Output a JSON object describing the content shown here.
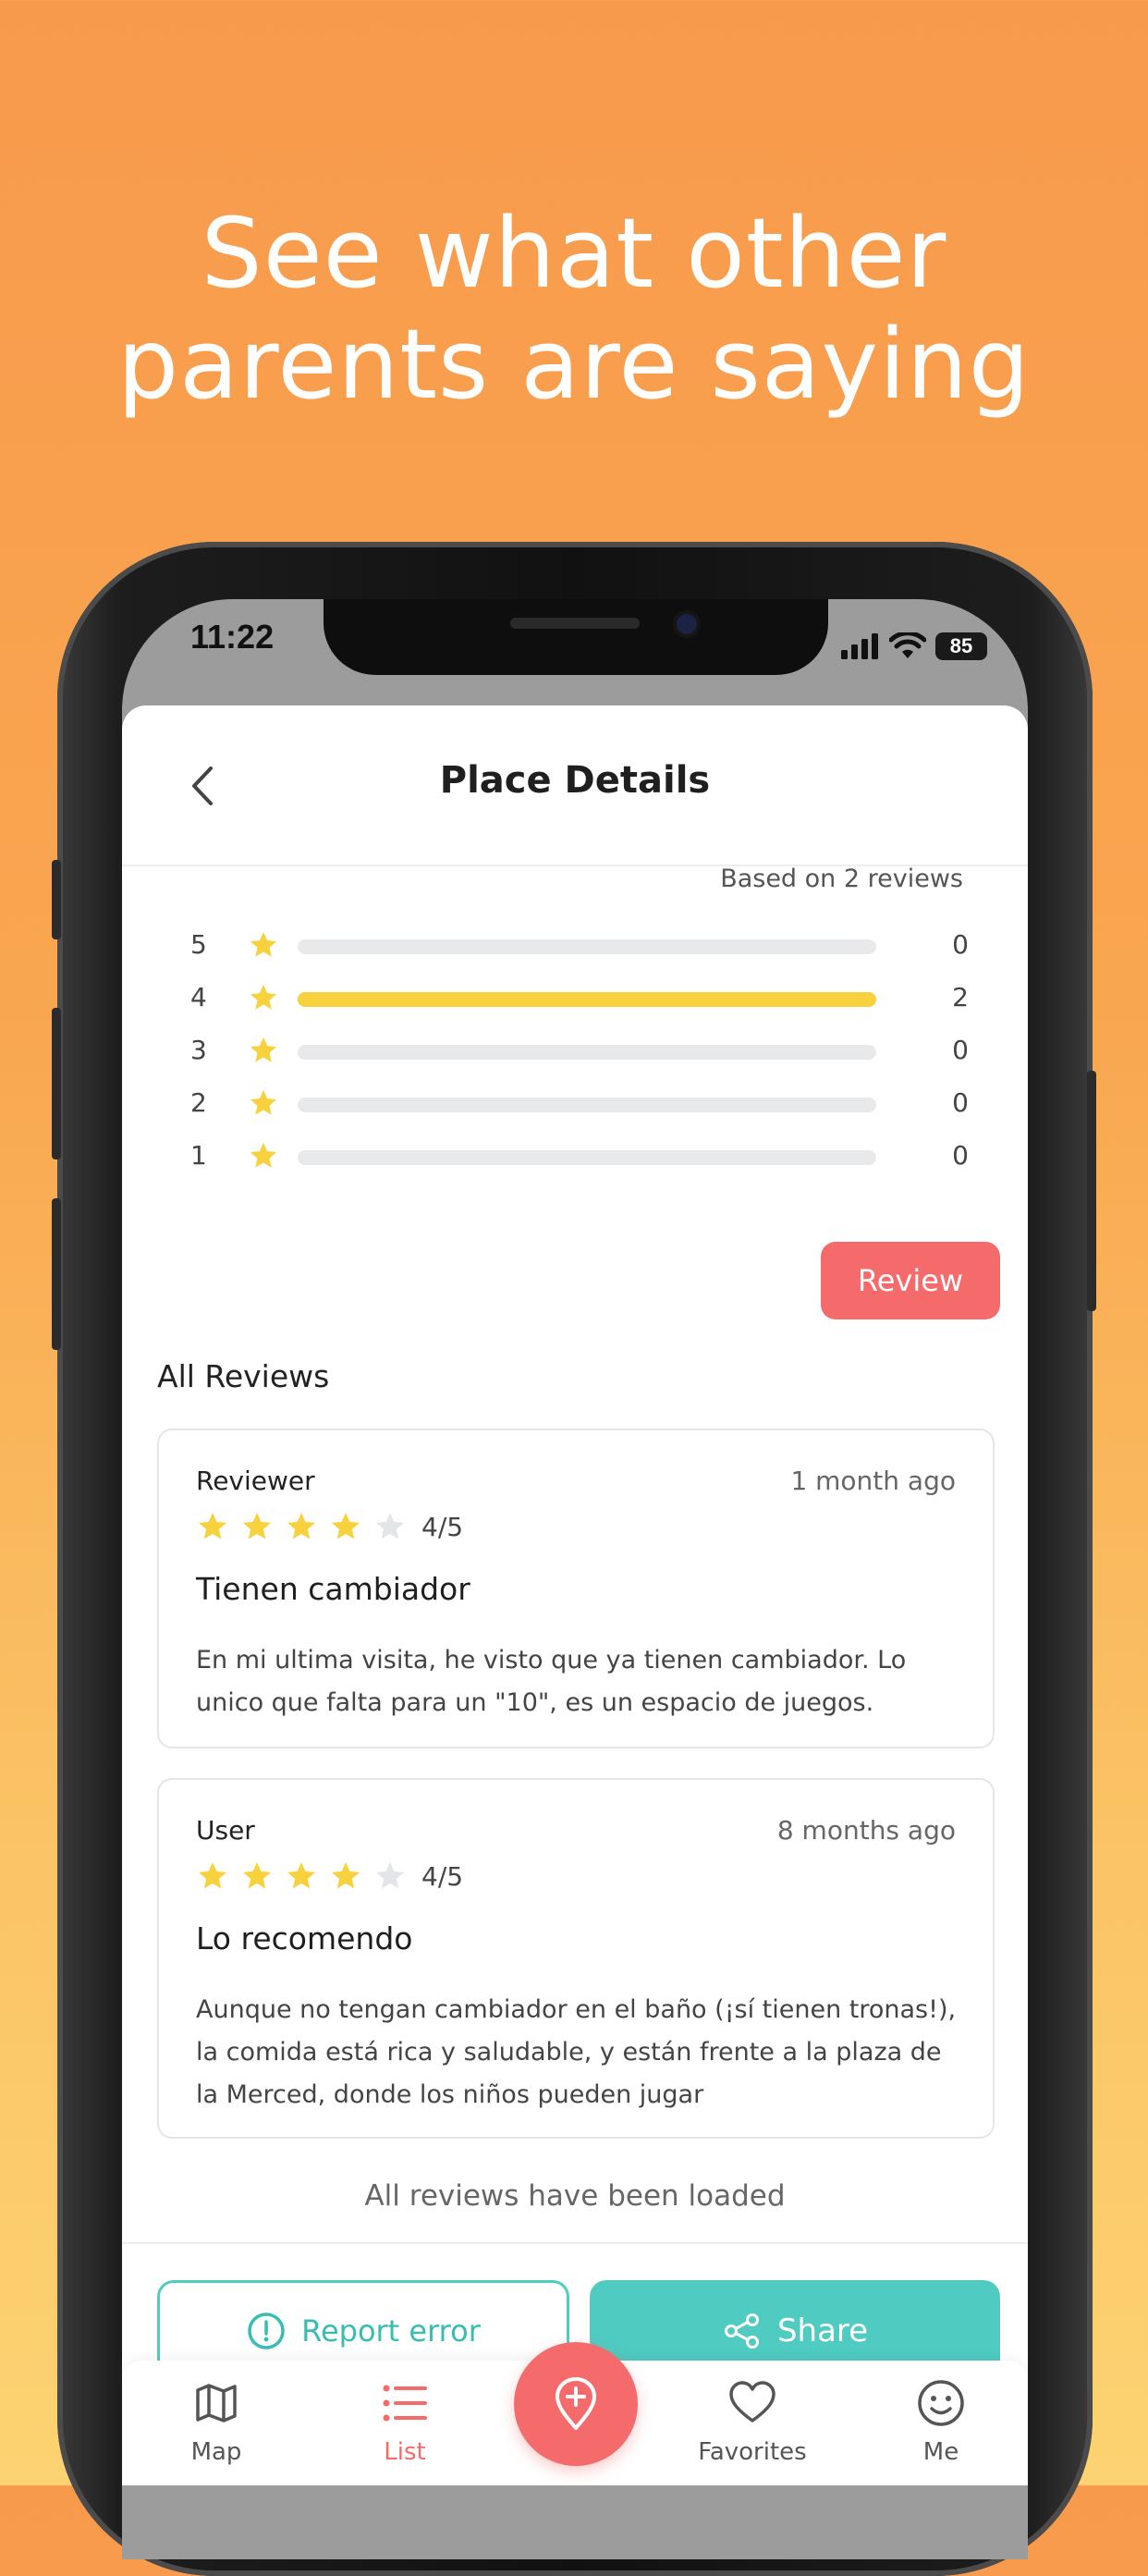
{
  "promo": {
    "line1": "See what other",
    "line2": "parents are saying"
  },
  "status_bar": {
    "time": "11:22",
    "battery": "85"
  },
  "nav": {
    "title": "Place Details"
  },
  "ratings": {
    "based_on": "Based on 2 reviews",
    "rows": [
      {
        "stars": "5",
        "count": "0",
        "fraction": 0
      },
      {
        "stars": "4",
        "count": "2",
        "fraction": 1
      },
      {
        "stars": "3",
        "count": "0",
        "fraction": 0
      },
      {
        "stars": "2",
        "count": "0",
        "fraction": 0
      },
      {
        "stars": "1",
        "count": "0",
        "fraction": 0
      }
    ]
  },
  "review_button": "Review",
  "all_reviews_label": "All Reviews",
  "reviews": [
    {
      "author": "Reviewer",
      "date": "1 month ago",
      "rating": 4,
      "score": "4/5",
      "title": "Tienen cambiador",
      "body": "En mi ultima visita, he visto que ya tienen cambiador. Lo unico que falta para un \"10\", es un espacio de juegos."
    },
    {
      "author": "User",
      "date": "8 months ago",
      "rating": 4,
      "score": "4/5",
      "title": "Lo recomendo",
      "body": "Aunque no tengan cambiador en el baño (¡sí tienen tronas!), la comida está rica y saludable, y están frente a la plaza de la Merced, donde los niños pueden jugar"
    }
  ],
  "loaded_text": "All reviews have been loaded",
  "actions": {
    "report": "Report error",
    "share": "Share"
  },
  "tabs": {
    "map": "Map",
    "list": "List",
    "favorites": "Favorites",
    "me": "Me"
  },
  "colors": {
    "accent_red": "#f56b6b",
    "accent_teal": "#4fcbc1",
    "star_yellow": "#f7d23e",
    "star_empty": "#e3e5e8",
    "bg_orange": "#f89a4c"
  },
  "icons": {
    "back": "chevron-left-icon",
    "star": "star-icon",
    "report": "alert-circle-icon",
    "share": "share-icon",
    "map": "map-icon",
    "list": "list-icon",
    "add": "add-place-icon",
    "favorites": "heart-icon",
    "me": "smiley-icon"
  }
}
